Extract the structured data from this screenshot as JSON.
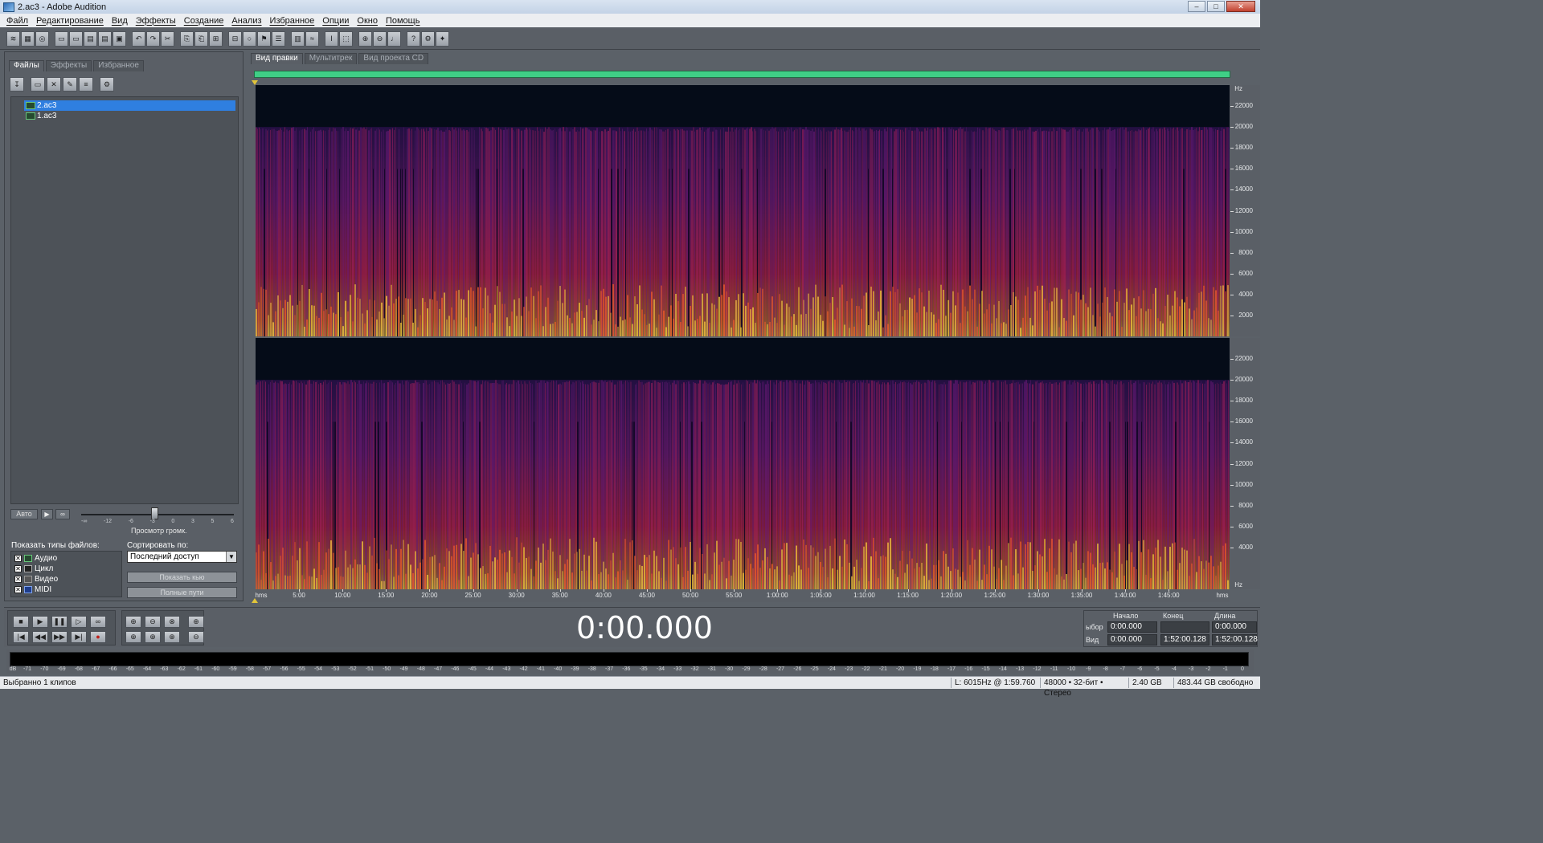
{
  "window": {
    "title": "2.ac3 - Adobe Audition",
    "controls": {
      "minimize": "–",
      "maximize": "□",
      "close": "✕"
    }
  },
  "menu": [
    "Файл",
    "Редактирование",
    "Вид",
    "Эффекты",
    "Создание",
    "Анализ",
    "Избранное",
    "Опции",
    "Окно",
    "Помощь"
  ],
  "toolbar_icons": [
    "edit-view-icon",
    "multitrack-view-icon",
    "cd-view-icon",
    "new-file-icon",
    "open-file-icon",
    "save-icon",
    "save-all-icon",
    "close-file-icon",
    "undo-icon",
    "redo-icon",
    "cut-icon",
    "copy-icon",
    "paste-icon",
    "mix-paste-icon",
    "trim-icon",
    "silence-icon",
    "mark-icon",
    "marker-list-icon",
    "spectral-view-icon",
    "waveform-view-icon",
    "select-tool-icon",
    "marquee-tool-icon",
    "zoom-in-icon",
    "zoom-out-icon",
    "metronome-icon",
    "help-icon",
    "settings-icon",
    "effect-icon"
  ],
  "left_panel": {
    "tabs": [
      "Файлы",
      "Эффекты",
      "Избранное"
    ],
    "active_tab": "Файлы",
    "files": [
      {
        "name": "2.ac3",
        "selected": true
      },
      {
        "name": "1.ac3",
        "selected": false
      }
    ],
    "auto_label": "Авто",
    "play_symbol": "▶",
    "loop_symbol": "∞",
    "volume_scale": [
      "-∞",
      "-12",
      "-6",
      "-3",
      "0",
      "3",
      "5",
      "6"
    ],
    "volume_label": "Просмотр громк.",
    "show_types_label": "Показать типы файлов:",
    "types": [
      {
        "label": "Аудио",
        "checked": true,
        "icon": "audio-icon"
      },
      {
        "label": "Цикл",
        "checked": true,
        "icon": "loop-icon"
      },
      {
        "label": "Видео",
        "checked": true,
        "icon": "video-icon"
      },
      {
        "label": "MIDI",
        "checked": true,
        "icon": "midi-icon"
      }
    ],
    "check_mark": "✕",
    "sort_label": "Сортировать по:",
    "sort_value": "Последний доступ",
    "sort_arrow": "▼",
    "show_cue_button": "Показать кью",
    "full_paths_button": "Полные пути"
  },
  "view_tabs": [
    {
      "label": "Вид правки",
      "active": true
    },
    {
      "label": "Мультитрек",
      "active": false
    },
    {
      "label": "Вид проекта CD",
      "active": false
    }
  ],
  "freq_axis": {
    "unit": "Hz",
    "labels": [
      "22000",
      "20000",
      "18000",
      "16000",
      "14000",
      "12000",
      "10000",
      "8000",
      "6000",
      "4000",
      "2000"
    ],
    "values": [
      22000,
      20000,
      18000,
      16000,
      14000,
      12000,
      10000,
      8000,
      6000,
      4000,
      2000
    ],
    "max": 24000
  },
  "time_axis": {
    "unit": "hms",
    "labels": [
      "5:00",
      "10:00",
      "15:00",
      "20:00",
      "25:00",
      "30:00",
      "35:00",
      "40:00",
      "45:00",
      "50:00",
      "55:00",
      "1:00:00",
      "1:05:00",
      "1:10:00",
      "1:15:00",
      "1:20:00",
      "1:25:00",
      "1:30:00",
      "1:35:00",
      "1:40:00",
      "1:45:00"
    ],
    "minutes": [
      5,
      10,
      15,
      20,
      25,
      30,
      35,
      40,
      45,
      50,
      55,
      60,
      65,
      70,
      75,
      80,
      85,
      90,
      95,
      100,
      105
    ],
    "total_minutes": 112.0
  },
  "transport": {
    "time": "0:00.000",
    "buttons": [
      "stop-icon",
      "play-icon",
      "pause-icon",
      "play-to-end-icon",
      "loop-play-icon",
      "go-to-start-icon",
      "rewind-icon",
      "fast-forward-icon",
      "go-to-end-icon",
      "record-icon"
    ],
    "button_symbols": [
      "■",
      "▶",
      "❚❚",
      "▷",
      "∞",
      "|◀",
      "◀◀",
      "▶▶",
      "▶|",
      "●"
    ],
    "zoom_buttons": [
      "zoom-in-horizontal-icon",
      "zoom-out-horizontal-icon",
      "zoom-full-icon",
      "zoom-in-vertical-icon",
      "zoom-to-selection-icon",
      "zoom-left-icon",
      "zoom-right-icon",
      "zoom-out-vertical-icon"
    ],
    "zoom_symbols": [
      "⊕",
      "⊖",
      "⊗",
      "⊕",
      "⊕",
      "⊕",
      "⊕",
      "⊖"
    ]
  },
  "selection": {
    "headers": {
      "start": "Начало",
      "end": "Конец",
      "length": "Длина"
    },
    "rows": [
      {
        "label": "ыбор",
        "start": "0:00.000",
        "end": "",
        "length": "0:00.000"
      },
      {
        "label": "Вид",
        "start": "0:00.000",
        "end": "1:52:00.128",
        "length": "1:52:00.128"
      }
    ]
  },
  "level_meter": {
    "unit": "dB",
    "labels": [
      "-71",
      "-70",
      "-69",
      "-68",
      "-67",
      "-66",
      "-65",
      "-64",
      "-63",
      "-62",
      "-61",
      "-60",
      "-59",
      "-58",
      "-57",
      "-56",
      "-55",
      "-54",
      "-53",
      "-52",
      "-51",
      "-50",
      "-49",
      "-48",
      "-47",
      "-46",
      "-45",
      "-44",
      "-43",
      "-42",
      "-41",
      "-40",
      "-39",
      "-38",
      "-37",
      "-36",
      "-35",
      "-34",
      "-33",
      "-32",
      "-31",
      "-30",
      "-29",
      "-28",
      "-27",
      "-26",
      "-25",
      "-24",
      "-23",
      "-22",
      "-21",
      "-20",
      "-19",
      "-18",
      "-17",
      "-16",
      "-15",
      "-14",
      "-13",
      "-12",
      "-11",
      "-10",
      "-9",
      "-8",
      "-7",
      "-6",
      "-5",
      "-4",
      "-3",
      "-2",
      "-1",
      "0"
    ]
  },
  "status": {
    "left": "Выбранно 1 клипов",
    "cursor": "L: 6015Hz @   1:59.760",
    "format": "48000 • 32-бит • Стерео",
    "size": "2.40 GB",
    "free": "483.44 GB свободно"
  },
  "colors": {
    "overview": "#3fcf86",
    "spectrogram_bg": "#050c18",
    "spectrogram_low": "#f6e04a",
    "spectrogram_mid": "#d8264a",
    "spectrogram_high": "#3b1264",
    "selection": "#2f7fe0"
  }
}
